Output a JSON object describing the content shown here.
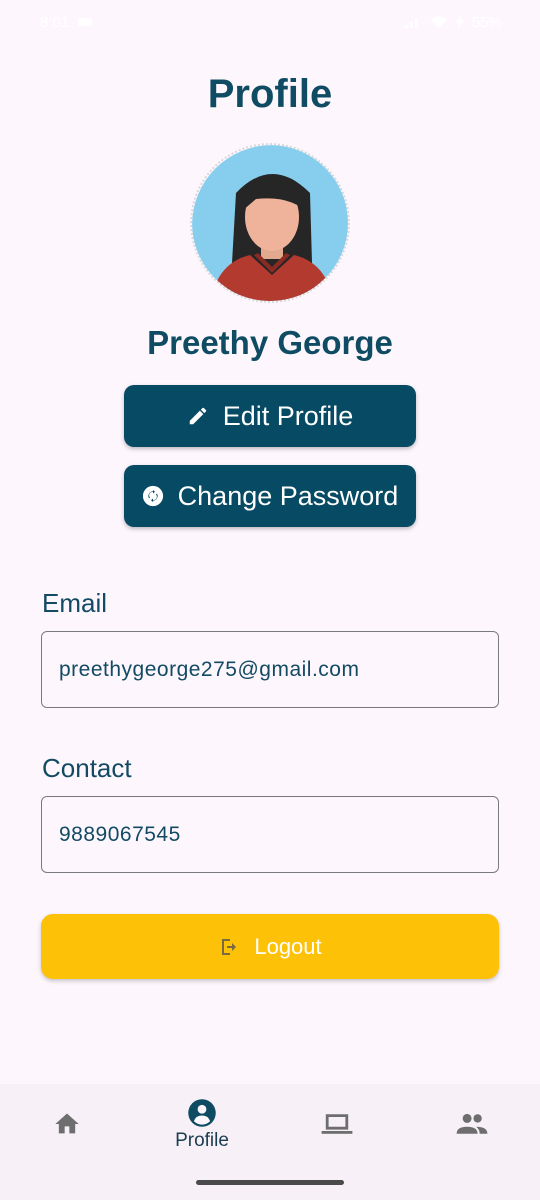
{
  "status_bar": {
    "time": "8:01",
    "battery": "55%"
  },
  "page": {
    "title": "Profile"
  },
  "user": {
    "name": "Preethy George"
  },
  "actions": {
    "edit_label": "Edit Profile",
    "password_label": "Change Password",
    "logout_label": "Logout"
  },
  "fields": {
    "email_label": "Email",
    "email_value": "preethygeorge275@gmail.com",
    "contact_label": "Contact",
    "contact_value": "9889067545"
  },
  "nav": {
    "items": [
      {
        "icon": "home-icon",
        "label": ""
      },
      {
        "icon": "profile-icon",
        "label": "Profile"
      },
      {
        "icon": "laptop-icon",
        "label": ""
      },
      {
        "icon": "people-icon",
        "label": ""
      }
    ]
  },
  "colors": {
    "primary": "#074a63",
    "accent": "#fdc107",
    "background": "#fdf7fd"
  }
}
